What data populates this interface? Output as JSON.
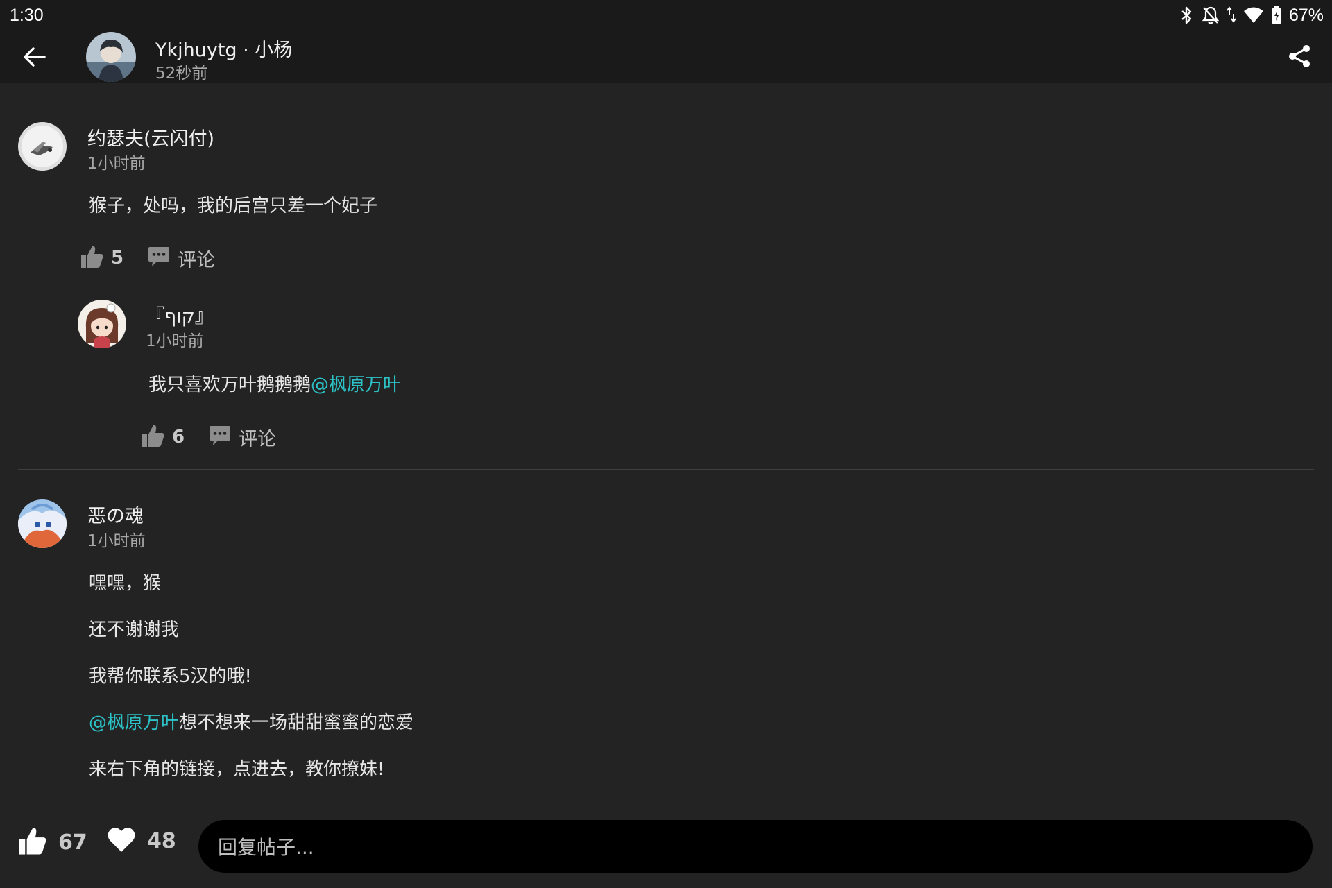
{
  "status_bar": {
    "time": "1:30",
    "battery_percent": "67%",
    "icons": [
      "bluetooth-icon",
      "notifications-off-icon",
      "signal-arrows-icon",
      "wifi-icon",
      "battery-icon"
    ]
  },
  "header": {
    "back_icon": "arrow-left-icon",
    "author": "Ykjhuytg · 小杨",
    "time": "52秒前",
    "share_icon": "share-icon"
  },
  "comments": [
    {
      "name": "约瑟夫(云闪付)",
      "time": "1小时前",
      "text": "猴子，处吗，我的后宫只差一个妃子",
      "likes": "5",
      "comment_label": "评论",
      "reply": {
        "name": "『קוף』",
        "time": "1小时前",
        "text": "我只喜欢万叶鹅鹅鹅",
        "mention": "@枫原万叶",
        "likes": "6",
        "comment_label": "评论"
      }
    },
    {
      "name": "恶の魂",
      "time": "1小时前",
      "lines": [
        "嘿嘿，猴",
        "还不谢谢我",
        "我帮你联系5汉的哦!"
      ],
      "mention_line": {
        "mention": "@枫原万叶",
        "text": "想不想来一场甜甜蜜蜜的恋爱"
      },
      "last_line": "来右下角的链接，点进去，教你撩妹!"
    }
  ],
  "bottom_bar": {
    "like_count": "67",
    "heart_count": "48",
    "reply_placeholder": "回复帖子..."
  },
  "colors": {
    "background": "#232323",
    "app_bar": "#1a1a1a",
    "mention": "#2cc3c8",
    "reply_box": "#000000"
  }
}
